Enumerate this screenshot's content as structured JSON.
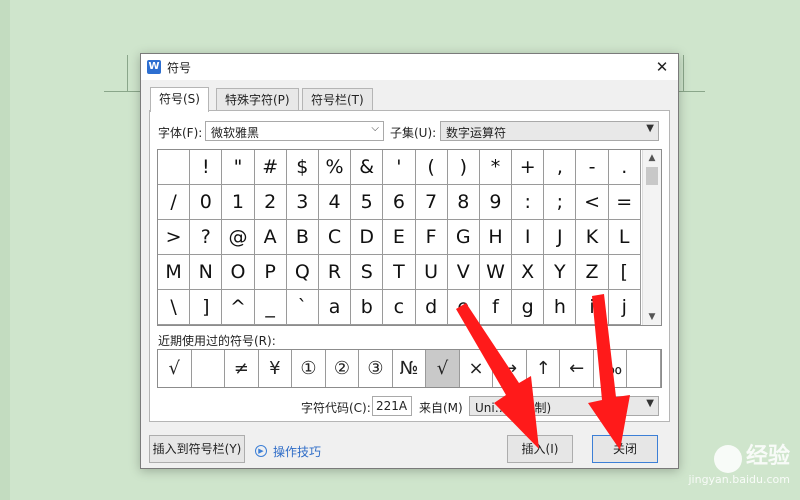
{
  "dialog": {
    "title": "符号",
    "app_icon": "W",
    "close": "✕"
  },
  "tabs": [
    {
      "label": "符号(S)",
      "active": true
    },
    {
      "label": "特殊字符(P)",
      "active": false
    },
    {
      "label": "符号栏(T)",
      "active": false
    }
  ],
  "font": {
    "label": "字体(F):",
    "value": "微软雅黑"
  },
  "subset": {
    "label": "子集(U):",
    "value": "数字运算符"
  },
  "symbols": [
    "",
    "!",
    "\"",
    "#",
    "$",
    "%",
    "&",
    "'",
    "(",
    ")",
    "*",
    "+",
    ",",
    "-",
    ".",
    "/",
    "0",
    "1",
    "2",
    "3",
    "4",
    "5",
    "6",
    "7",
    "8",
    "9",
    ":",
    ";",
    "<",
    "=",
    ">",
    "?",
    "@",
    "A",
    "B",
    "C",
    "D",
    "E",
    "F",
    "G",
    "H",
    "I",
    "J",
    "K",
    "L",
    "M",
    "N",
    "O",
    "P",
    "Q",
    "R",
    "S",
    "T",
    "U",
    "V",
    "W",
    "X",
    "Y",
    "Z",
    "[",
    "\\",
    "]",
    "^",
    "_",
    "`",
    "a",
    "b",
    "c",
    "d",
    "e",
    "f",
    "g",
    "h",
    "i",
    "j"
  ],
  "recent": {
    "label": "近期使用过的符号(R):",
    "items": [
      "√",
      "",
      "≠",
      "¥",
      "①",
      "②",
      "③",
      "№",
      "√",
      "×",
      "→",
      "↑",
      "←",
      "‰",
      ""
    ],
    "selected_index": 8
  },
  "char_code": {
    "label": "字符代码(C):",
    "value": "221A"
  },
  "from": {
    "label": "来自(M)",
    "value": "Uni… 六进制)"
  },
  "buttons": {
    "insert_to_bar": "插入到符号栏(Y)",
    "tips": "操作技巧",
    "insert": "插入(I)",
    "close": "关闭"
  },
  "watermark": {
    "brand": "经验",
    "url": "jingyan.baidu.com"
  }
}
